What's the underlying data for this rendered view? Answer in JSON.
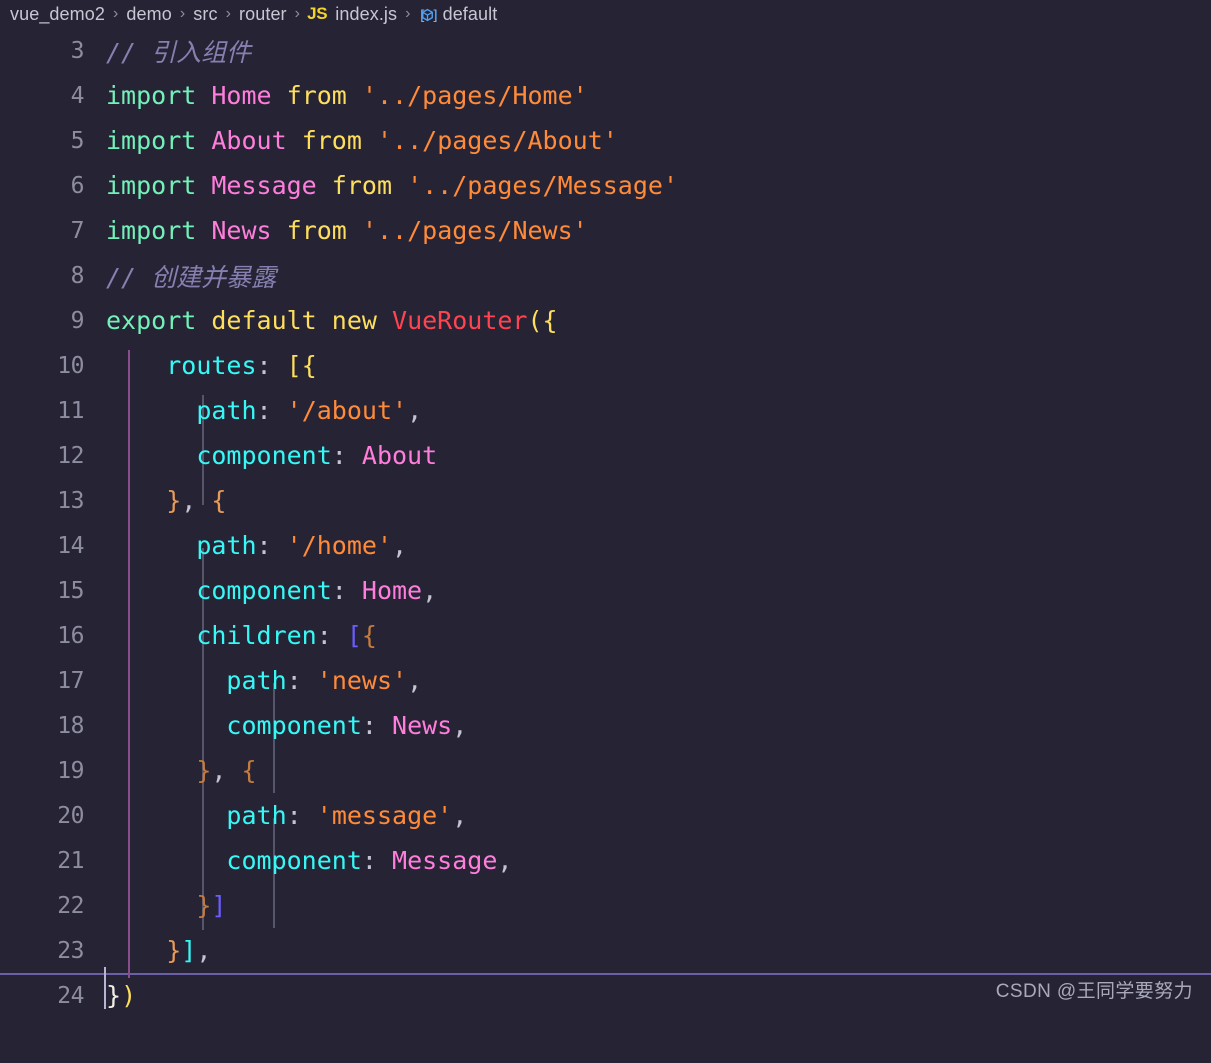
{
  "window": {
    "background": "#262335",
    "theme_name": "synthwave-dark"
  },
  "breadcrumb": {
    "separator": "›",
    "items": [
      {
        "label": "vue_demo2",
        "icon": null
      },
      {
        "label": "demo",
        "icon": null
      },
      {
        "label": "src",
        "icon": null
      },
      {
        "label": "router",
        "icon": null
      },
      {
        "label": "index.js",
        "icon": "js-badge",
        "badge": "JS"
      },
      {
        "label": "default",
        "icon": "symbol-cube-icon"
      }
    ]
  },
  "editor": {
    "language": "javascript",
    "file_name": "index.js",
    "current_line": 24,
    "first_visible_line": 3,
    "last_visible_line": 24,
    "lines": [
      {
        "number": "3",
        "text": "// 引入组件"
      },
      {
        "number": "4",
        "text": "import Home from '../pages/Home'"
      },
      {
        "number": "5",
        "text": "import About from '../pages/About'"
      },
      {
        "number": "6",
        "text": "import Message from '../pages/Message'"
      },
      {
        "number": "7",
        "text": "import News from '../pages/News'"
      },
      {
        "number": "8",
        "text": "// 创建并暴露"
      },
      {
        "number": "9",
        "text": "export default new VueRouter({"
      },
      {
        "number": "10",
        "text": "    routes: [{"
      },
      {
        "number": "11",
        "text": "        path: '/about',"
      },
      {
        "number": "12",
        "text": "        component: About"
      },
      {
        "number": "13",
        "text": "    }, {"
      },
      {
        "number": "14",
        "text": "        path: '/home',"
      },
      {
        "number": "15",
        "text": "        component: Home,"
      },
      {
        "number": "16",
        "text": "        children: [{"
      },
      {
        "number": "17",
        "text": "            path: 'news',"
      },
      {
        "number": "18",
        "text": "            component: News,"
      },
      {
        "number": "19",
        "text": "        }, {"
      },
      {
        "number": "20",
        "text": "            path: 'message',"
      },
      {
        "number": "21",
        "text": "            component: Message,"
      },
      {
        "number": "22",
        "text": "        }]"
      },
      {
        "number": "23",
        "text": "    }],"
      },
      {
        "number": "24",
        "text": "})"
      }
    ],
    "tokens": {
      "line3": {
        "comment": "// 引入组件"
      },
      "line4": {
        "kw": "import",
        "cls": "Home",
        "from": "from",
        "str": "'../pages/Home'"
      },
      "line5": {
        "kw": "import",
        "cls": "About",
        "from": "from",
        "str": "'../pages/About'"
      },
      "line6": {
        "kw": "import",
        "cls": "Message",
        "from": "from",
        "str": "'../pages/Message'"
      },
      "line7": {
        "kw": "import",
        "cls": "News",
        "from": "from",
        "str": "'../pages/News'"
      },
      "line8": {
        "comment": "// 创建并暴露"
      },
      "line9": {
        "kw": "export",
        "kw2": "default",
        "kw3": "new",
        "fn": "VueRouter",
        "open": "({"
      },
      "line10": {
        "prop": "routes",
        "colon": ":",
        "open": "[{"
      },
      "line11": {
        "prop": "path",
        "colon": ":",
        "str": "'/about'",
        "comma": ","
      },
      "line12": {
        "prop": "component",
        "colon": ":",
        "cls": "About"
      },
      "line13": {
        "close": "}",
        "comma": ",",
        "open": "{"
      },
      "line14": {
        "prop": "path",
        "colon": ":",
        "str": "'/home'",
        "comma": ","
      },
      "line15": {
        "prop": "component",
        "colon": ":",
        "cls": "Home",
        "comma": ","
      },
      "line16": {
        "prop": "children",
        "colon": ":",
        "open_b": "[",
        "open_c": "{"
      },
      "line17": {
        "prop": "path",
        "colon": ":",
        "str": "'news'",
        "comma": ","
      },
      "line18": {
        "prop": "component",
        "colon": ":",
        "cls": "News",
        "comma": ","
      },
      "line19": {
        "close": "}",
        "comma": ",",
        "open": "{"
      },
      "line20": {
        "prop": "path",
        "colon": ":",
        "str": "'message'",
        "comma": ","
      },
      "line21": {
        "prop": "component",
        "colon": ":",
        "cls": "Message",
        "comma": ","
      },
      "line22": {
        "close_c": "}",
        "close_b": "]"
      },
      "line23": {
        "close_c": "}",
        "close_b": "]",
        "comma": ","
      },
      "line24": {
        "close_c": "}",
        "close_p": ")"
      }
    },
    "colors": {
      "background": "#262335",
      "line_number": "#8d8da0",
      "comment": "#8680b0",
      "keyword": "#72f1b8",
      "keyword_alt": "#fede5d",
      "class_name": "#ff7edb",
      "function_name": "#fe4450",
      "string": "#ff8b39",
      "property": "#36f9f6",
      "punctuation": "#c4c4d4",
      "indent_guide_active": "#8a4d8c",
      "indent_guide": "#55556b",
      "current_line_border": "#6b5fa8"
    }
  },
  "watermark": {
    "text": "CSDN @王同学要努力"
  }
}
